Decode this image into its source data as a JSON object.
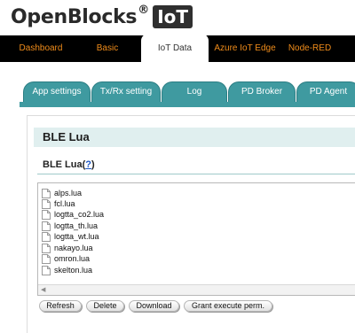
{
  "logo": {
    "text": "OpenBlocks",
    "reg": "®",
    "badge": "IoT"
  },
  "topnav": {
    "tabs": [
      {
        "label": "Dashboard",
        "active": false
      },
      {
        "label": "Basic",
        "active": false
      },
      {
        "label": "IoT Data",
        "active": true
      },
      {
        "label": "Azure IoT Edge",
        "active": false
      },
      {
        "label": "Node-RED",
        "active": false
      }
    ]
  },
  "subtabs": [
    {
      "label": "App settings"
    },
    {
      "label": "Tx/Rx setting"
    },
    {
      "label": "Log"
    },
    {
      "label": "PD Broker"
    },
    {
      "label": "PD Agent"
    }
  ],
  "panel": {
    "title": "BLE Lua",
    "section_title": "BLE Lua(",
    "help_link": "?",
    "section_title_close": ")"
  },
  "files": [
    "alps.lua",
    "fcl.lua",
    "logtta_co2.lua",
    "logtta_th.lua",
    "logtta_wt.lua",
    "nakayo.lua",
    "omron.lua",
    "skelton.lua"
  ],
  "scroll_arrow": "◀",
  "buttons": {
    "refresh": "Refresh",
    "delete": "Delete",
    "download": "Download",
    "grant": "Grant execute perm."
  },
  "colors": {
    "nav_bg": "#000000",
    "nav_text": "#f08c1a",
    "subtab_bg": "#3f9aa0",
    "panel_header_bg": "#e0efef",
    "link": "#1a55c4"
  }
}
